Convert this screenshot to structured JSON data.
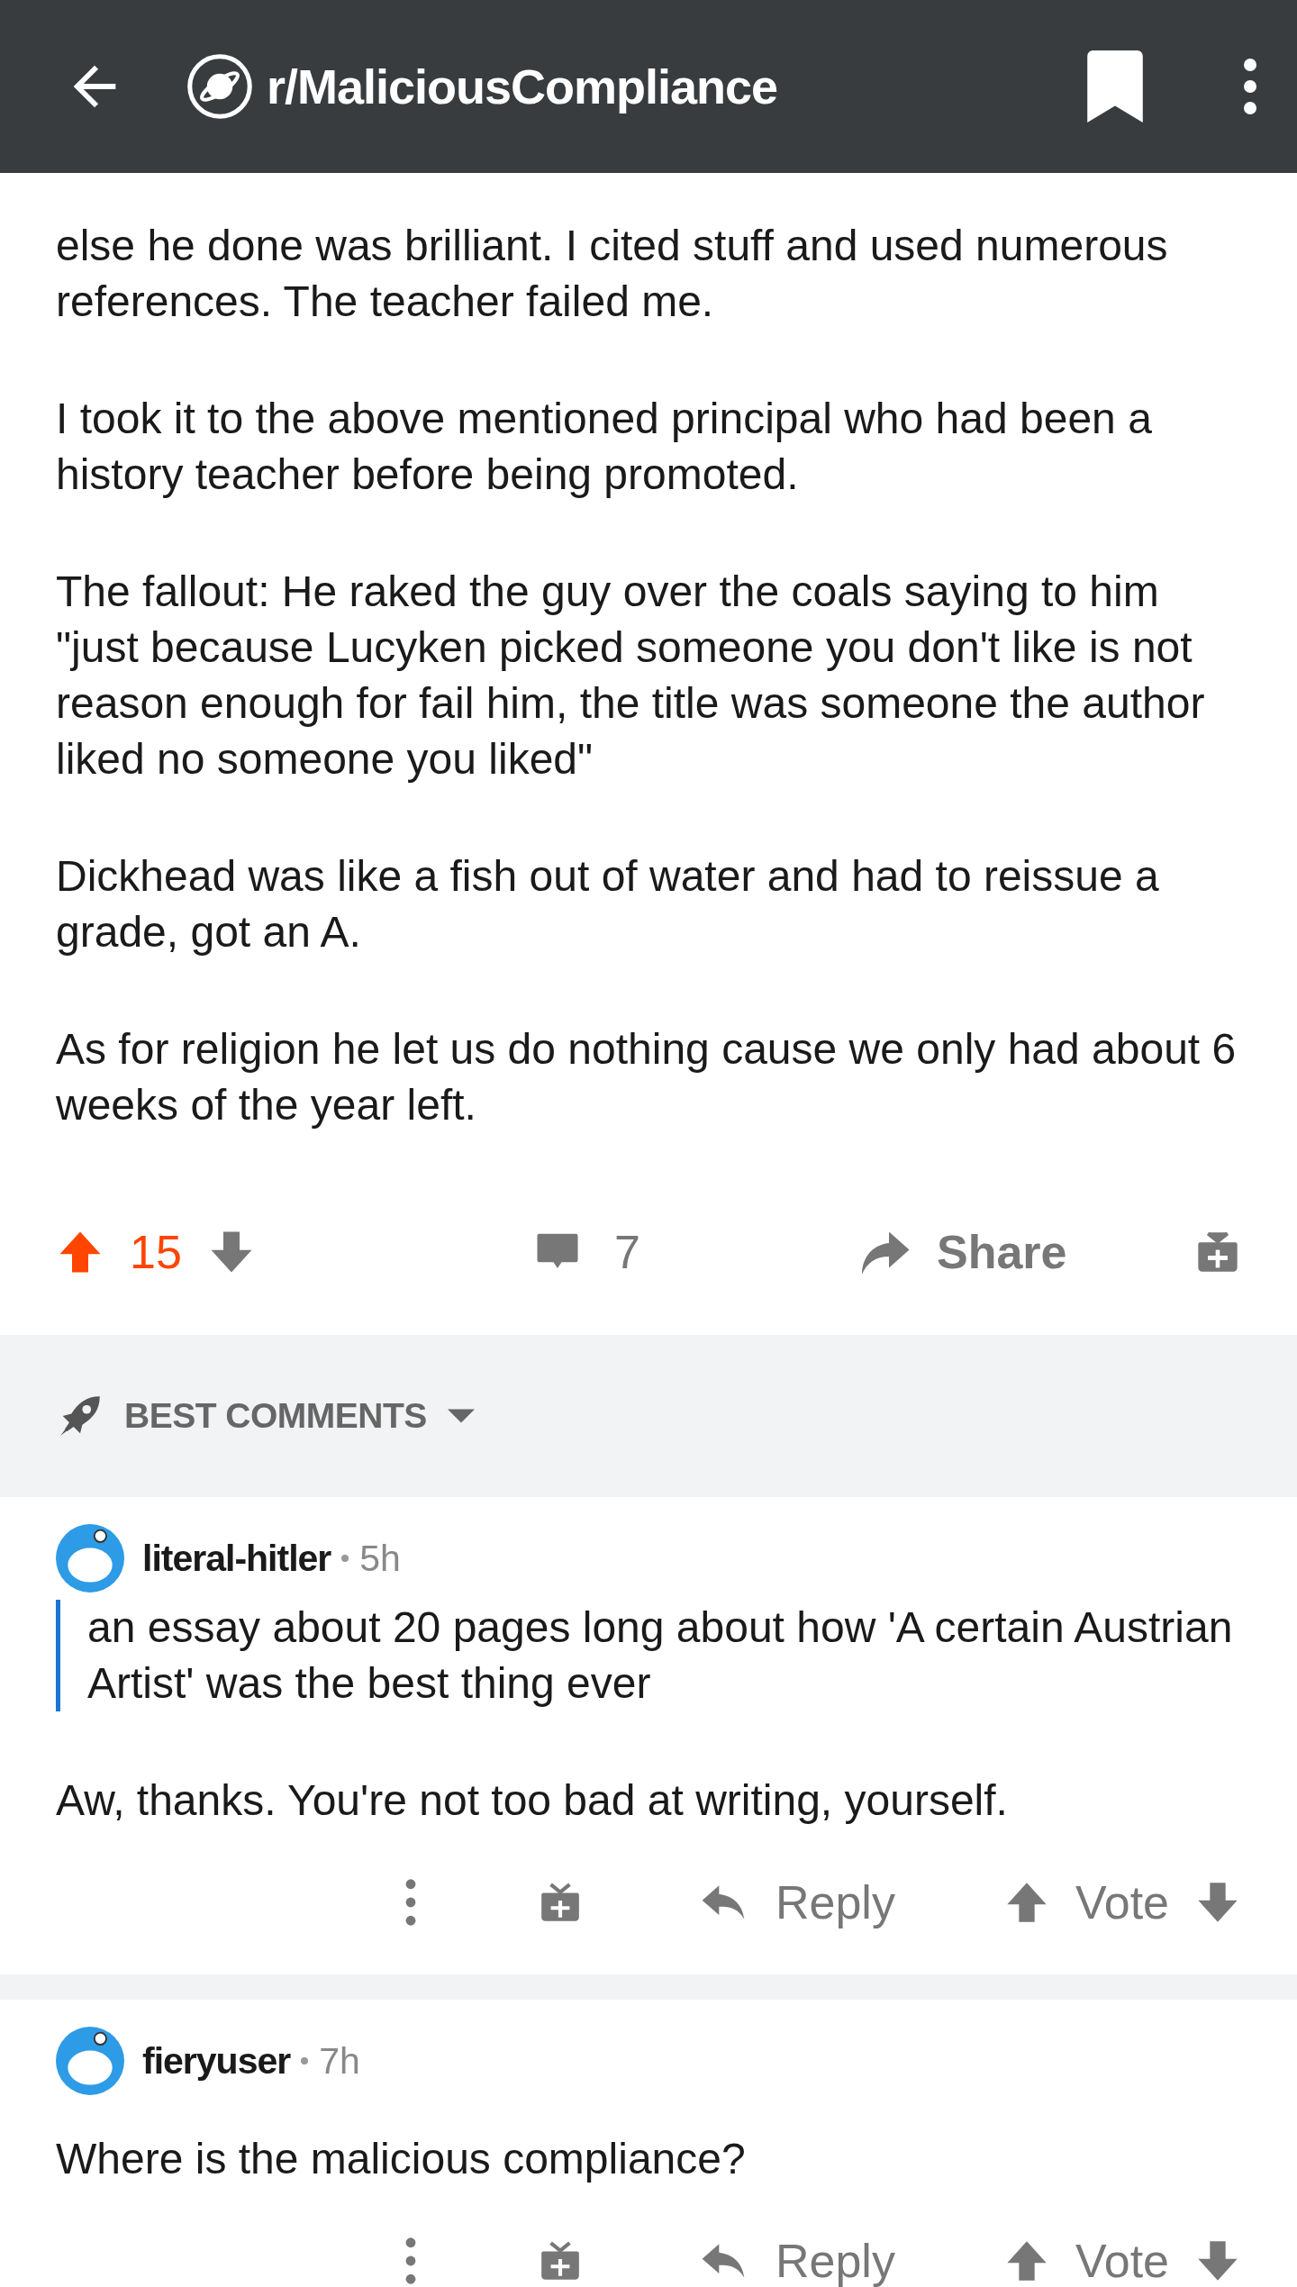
{
  "header": {
    "title": "r/MaliciousCompliance"
  },
  "post": {
    "paragraphs": [
      "else he done was brilliant. I cited stuff and used numerous references. The teacher failed me.",
      "I took it to the above mentioned principal who had been a history teacher before being promoted.",
      "The fallout: He raked the guy over the coals saying to him \"just because Lucyken picked someone you don't like is not reason enough for fail him, the title was someone the author liked no someone you liked\"",
      "Dickhead was like a fish out of water and had to reissue a grade, got an A.",
      "As for religion he let us do nothing cause we only had about 6 weeks of the year left."
    ],
    "score": "15",
    "upvoted": true,
    "comments_count": "7",
    "share": "Share"
  },
  "sort": {
    "label": "BEST COMMENTS"
  },
  "comments": [
    {
      "author": "literal-hitler",
      "age": "5h",
      "quote": "an essay about 20 pages long about how 'A certain Austrian Artist' was the best thing ever",
      "body": "Aw, thanks. You're not too bad at writing, yourself.",
      "reply": "Reply",
      "vote": "Vote"
    },
    {
      "author": "fieryuser",
      "age": "7h",
      "body": "Where is the malicious compliance?",
      "reply": "Reply",
      "vote": "Vote"
    }
  ]
}
